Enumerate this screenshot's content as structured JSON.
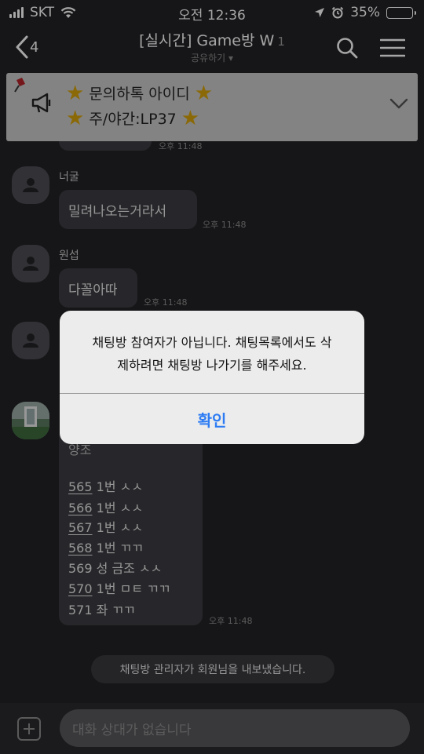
{
  "status_bar": {
    "carrier": "SKT",
    "time": "오전 12:36",
    "battery": "35%"
  },
  "header": {
    "back_count": "4",
    "title": "[실시간] Game방 W",
    "member_count": "1",
    "subtitle": "공유하기 ▾"
  },
  "notice": {
    "line1": "문의하톡 아이디",
    "line2": "주/야간:LP37"
  },
  "messages": [
    {
      "name": "",
      "text": "",
      "time": "오후 11:48"
    },
    {
      "name": "너굴",
      "text": "밀려나오는거라서",
      "time": "오후 11:48"
    },
    {
      "name": "원섭",
      "text": "다꼴아따",
      "time": "오후 11:48"
    }
  ],
  "list_message": {
    "header": "양조",
    "rows": [
      {
        "num": "565",
        "rest": " 1번 ㅅㅅ"
      },
      {
        "num": "566",
        "rest": " 1번 ㅅㅅ"
      },
      {
        "num": "567",
        "rest": " 1번 ㅅㅅ"
      },
      {
        "num": "568",
        "rest": " 1번 ㄲㄲ"
      },
      {
        "num": "569",
        "rest": " 성 금조 ㅅㅅ"
      },
      {
        "num": "570",
        "rest": " 1번 ㅁㅌ ㄲㄲ"
      },
      {
        "num": "571",
        "rest": " 좌 ㄲㄲ"
      }
    ],
    "time": "오후 11:48"
  },
  "system_message": "채팅방 관리자가 회원님을 내보냈습니다.",
  "input": {
    "placeholder": "대화 상대가 없습니다"
  },
  "alert": {
    "line1": "채팅방 참여자가 아닙니다. 채팅목록에서도 삭",
    "line2": "제하려면 채팅방 나가기를 해주세요.",
    "ok_label": "확인"
  },
  "colors": {
    "accent": "#2d7cf4",
    "background": "#222226",
    "notice_bg": "#c9c9c9",
    "star": "#d4a20a"
  }
}
